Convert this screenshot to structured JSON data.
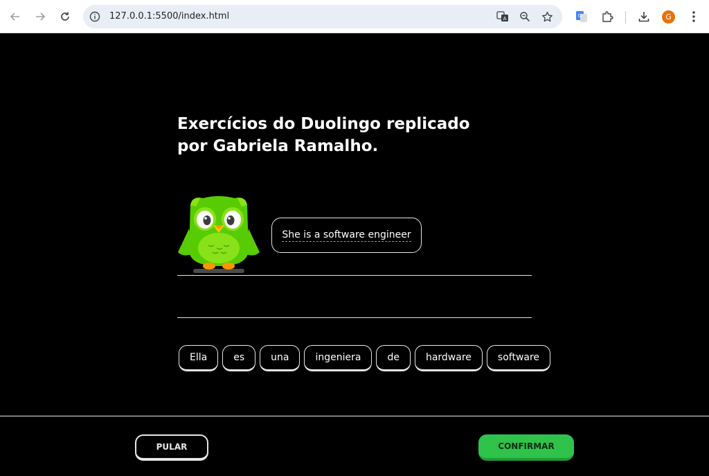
{
  "browser": {
    "url": "127.0.0.1:5500/index.html",
    "profile_initial": "G",
    "icons": [
      "back-icon",
      "forward-icon",
      "reload-icon",
      "info-icon",
      "translate-icon",
      "zoom-icon",
      "star-icon",
      "google-translate-extension-icon",
      "extensions-icon",
      "download-icon",
      "avatar",
      "menu-icon"
    ]
  },
  "page": {
    "title": "Exercícios do Duolingo replicado por Gabriela Ramalho.",
    "prompt_sentence": "She is a software engineer",
    "word_bank": [
      "Ella",
      "es",
      "una",
      "ingeniera",
      "de",
      "hardware",
      "software"
    ],
    "skip_label": "PULAR",
    "confirm_label": "CONFIRMAR"
  },
  "colors": {
    "background": "#000000",
    "accent_green": "#2fc34b",
    "owl_green": "#58cc02",
    "text": "#ffffff"
  }
}
